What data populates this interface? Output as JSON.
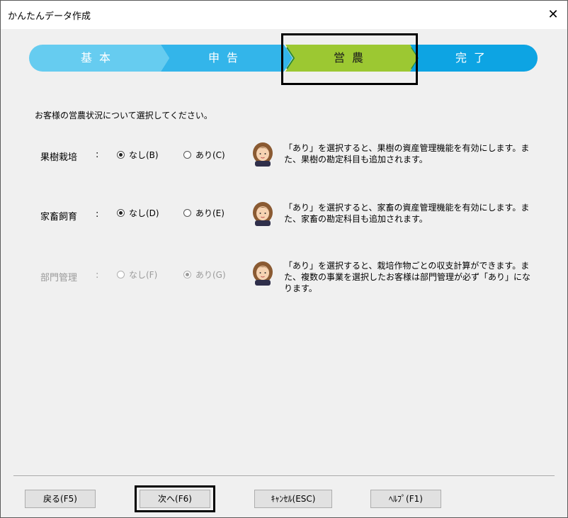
{
  "window": {
    "title": "かんたんデータ作成",
    "close_glyph": "✕"
  },
  "steps": [
    {
      "label": "基本",
      "color": "#66ccf0"
    },
    {
      "label": "申告",
      "color": "#33b5ea"
    },
    {
      "label": "営農",
      "color": "#9cc832"
    },
    {
      "label": "完了",
      "color": "#0da4e3"
    }
  ],
  "prompt": "お客様の営農状況について選択してください。",
  "rows": [
    {
      "label": "果樹栽培",
      "colon": ":",
      "option_no": "なし(B)",
      "option_yes": "あり(C)",
      "selected": "no",
      "disabled": false,
      "note": "「あり」を選択すると、果樹の資産管理機能を有効にします。また、果樹の勘定科目も追加されます。"
    },
    {
      "label": "家畜飼育",
      "colon": ":",
      "option_no": "なし(D)",
      "option_yes": "あり(E)",
      "selected": "no",
      "disabled": false,
      "note": "「あり」を選択すると、家畜の資産管理機能を有効にします。また、家畜の勘定科目も追加されます。"
    },
    {
      "label": "部門管理",
      "colon": ":",
      "option_no": "なし(F)",
      "option_yes": "あり(G)",
      "selected": "yes",
      "disabled": true,
      "note": "「あり」を選択すると、栽培作物ごとの収支計算ができます。また、複数の事業を選択したお客様は部門管理が必ず「あり」になります。"
    }
  ],
  "buttons": {
    "back": "戻る(F5)",
    "next": "次へ(F6)",
    "cancel": "ｷｬﾝｾﾙ(ESC)",
    "help": "ﾍﾙﾌﾟ(F1)"
  }
}
